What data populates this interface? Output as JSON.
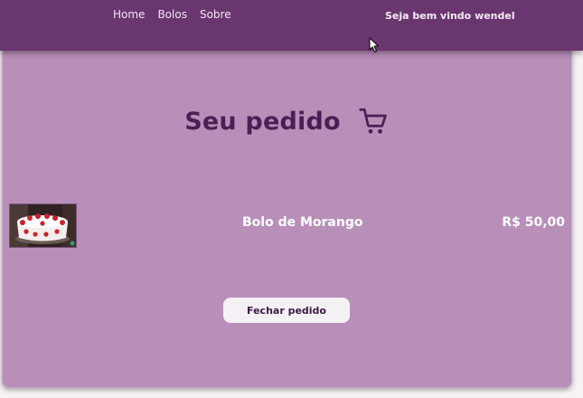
{
  "nav": {
    "links": [
      "Home",
      "Bolos",
      "Sobre"
    ],
    "welcome": "Seja bem vindo wendel"
  },
  "order": {
    "title": "Seu pedido",
    "cart_icon": "shopping-cart-icon",
    "items": [
      {
        "name": "Bolo de Morango",
        "price": "R$ 50,00",
        "image": "strawberry-cake-image"
      }
    ],
    "close_button": "Fechar pedido"
  },
  "colors": {
    "navbar": "#6a3670",
    "card": "#b88fb9",
    "title": "#4a1f55",
    "button_bg": "#f4f1f4"
  }
}
